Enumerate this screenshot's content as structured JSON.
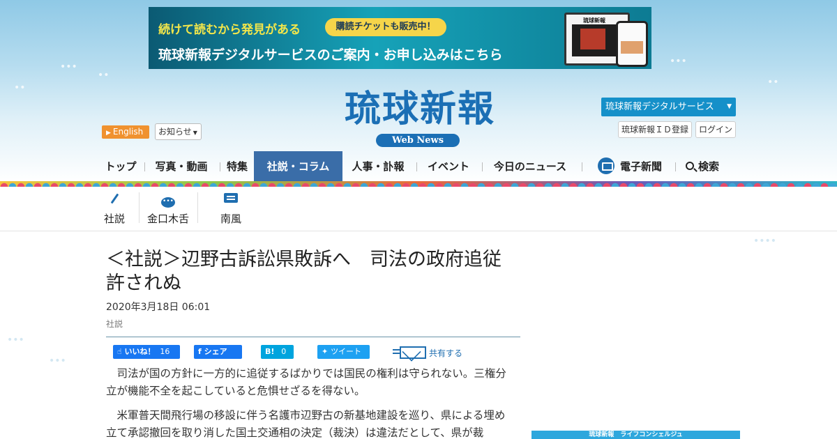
{
  "banner": {
    "tagline": "続けて読むから発見がある",
    "pill": "購読チケットも販売中！",
    "main": "琉球新報デジタルサービスのご案内・お申し込みはこちら",
    "device_title": "琉球新報"
  },
  "header": {
    "logo": "琉球新報",
    "logo_sub": "Web News",
    "english": "English",
    "notice": "お知らせ",
    "digital_service": "琉球新報デジタルサービス",
    "register": "琉球新報ＩＤ登録",
    "login": "ログイン"
  },
  "nav": {
    "items": [
      "トップ",
      "写真・動画",
      "特集",
      "社説・コラム",
      "人事・訃報",
      "イベント",
      "今日のニュース",
      "電子新聞",
      "検索"
    ],
    "active": "社説・コラム"
  },
  "subnav": {
    "items": [
      {
        "label": "社説",
        "icon": "pen-icon"
      },
      {
        "label": "金口木舌",
        "icon": "speech-bubble-icon"
      },
      {
        "label": "南風",
        "icon": "comment-icon"
      }
    ]
  },
  "article": {
    "title": "＜社説＞辺野古訴訟県敗訴へ　司法の政府追従許されぬ",
    "date": "2020年3月18日 06:01",
    "category": "社説",
    "paragraphs": [
      "司法が国の方針に一方的に追従するばかりでは国民の権利は守られない。三権分立が機能不全を起こしていると危惧せざるを得ない。",
      "米軍普天間飛行場の移設に伴う名護市辺野古の新基地建設を巡り、県による埋め立て承認撤回を取り消した国土交通相の決定（裁決）は違法だとして、県が裁"
    ]
  },
  "share": {
    "like_label": "いいね！",
    "like_count": "16",
    "facebook": "シェア",
    "hatena": "B!",
    "hatena_count": "0",
    "twitter": "ツイート",
    "share_label": "共有する"
  },
  "sidebar": {
    "ad_text": "琉球新報　ライフコンシェルジュ"
  },
  "colors": {
    "brand_blue": "#1b6fb5",
    "nav_active": "#3a6da8",
    "english_orange": "#f0922f",
    "digital_blue": "#1590c9"
  }
}
